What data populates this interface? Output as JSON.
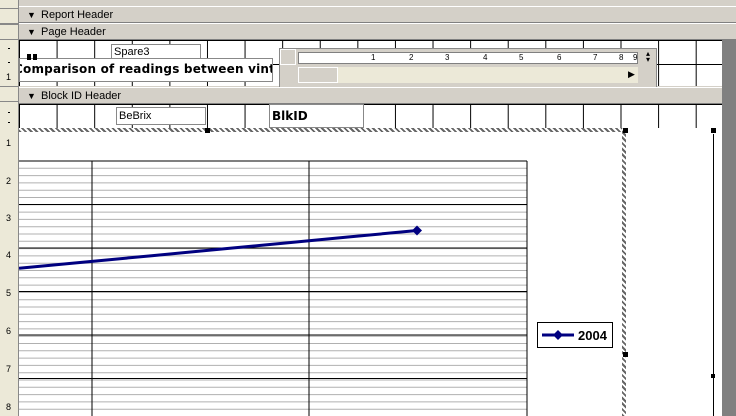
{
  "sections": {
    "report_header": "Report Header",
    "page_header": "Page Header",
    "block_id_header": "Block ID Header"
  },
  "page_header": {
    "spare_field": "Spare3",
    "title_label": "Comparison of readings between vintages",
    "ruler_numbers": [
      "1",
      "2",
      "3",
      "4",
      "5",
      "6",
      "7",
      "8",
      "9"
    ]
  },
  "block_header": {
    "brix_field": "BeBrix",
    "blkid_label": "BlkID"
  },
  "left_ruler_numbers": [
    "1",
    "2",
    "3",
    "4",
    "5",
    "6",
    "7",
    "8"
  ],
  "icons": {
    "section_collapse": "section-arrow-icon",
    "scroll_left": "scroll-left-icon",
    "scroll_right": "scroll-right-icon"
  },
  "chart_data": {
    "type": "line",
    "series": [
      {
        "name": "2004",
        "values": [
          1.9,
          2.0,
          2.1,
          2.2,
          2.3,
          2.4,
          2.5
        ]
      }
    ],
    "line_color": "#000080",
    "grid": true,
    "legend": "right"
  }
}
